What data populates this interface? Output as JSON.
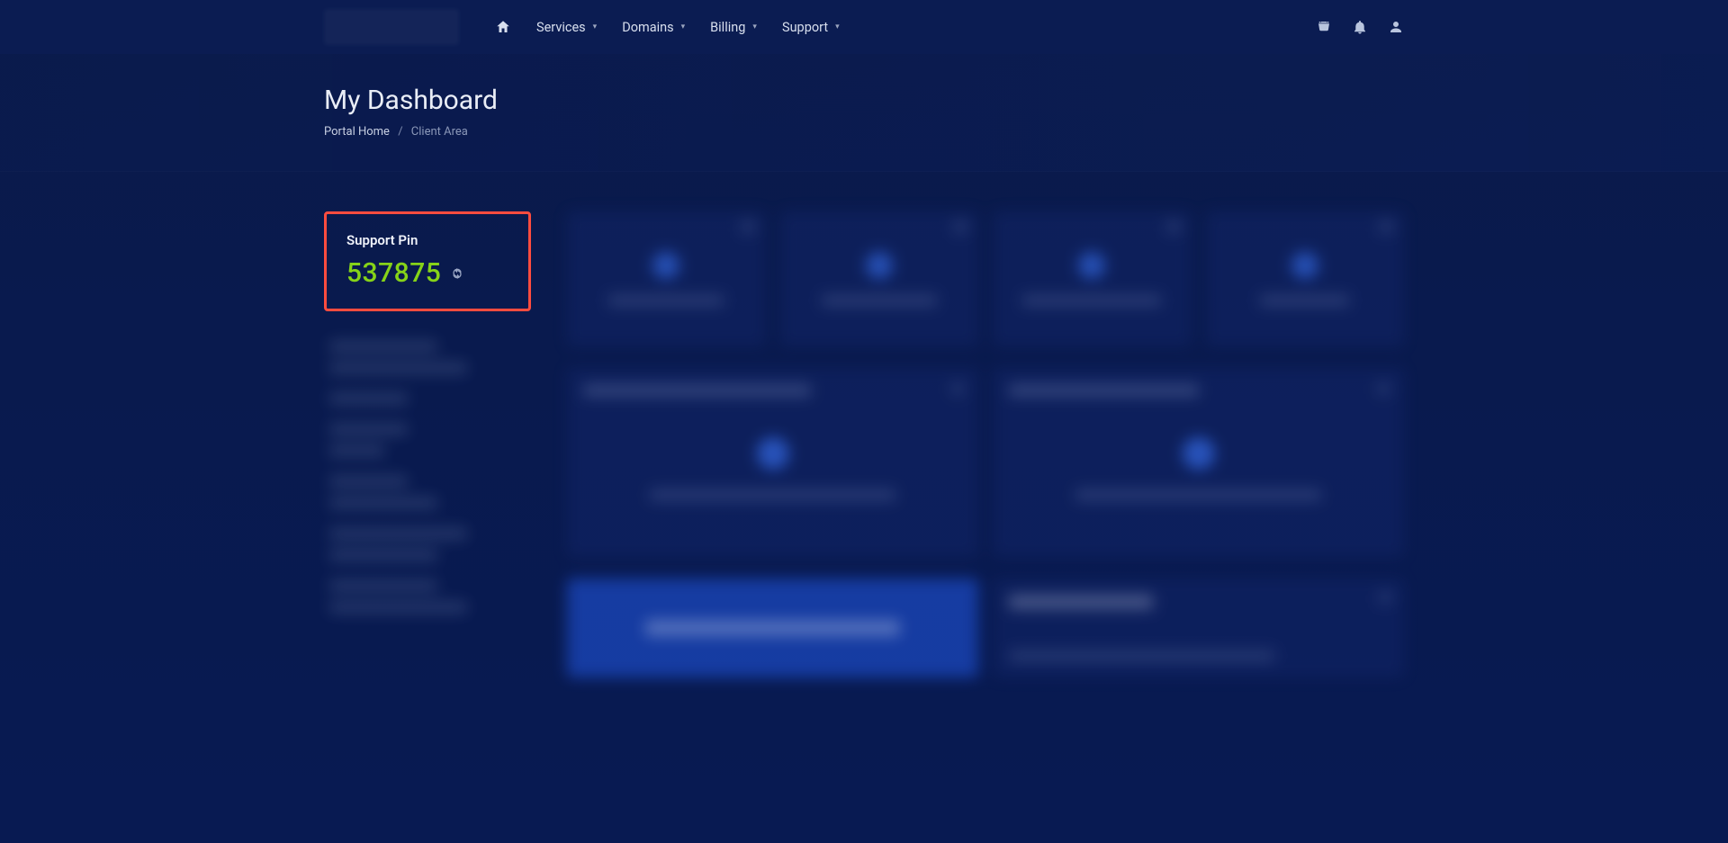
{
  "nav": {
    "items": [
      {
        "label": "Services"
      },
      {
        "label": "Domains"
      },
      {
        "label": "Billing"
      },
      {
        "label": "Support"
      }
    ]
  },
  "page": {
    "title": "My Dashboard"
  },
  "breadcrumb": {
    "home": "Portal Home",
    "current": "Client Area"
  },
  "support_pin": {
    "title": "Support Pin",
    "value": "537875"
  }
}
